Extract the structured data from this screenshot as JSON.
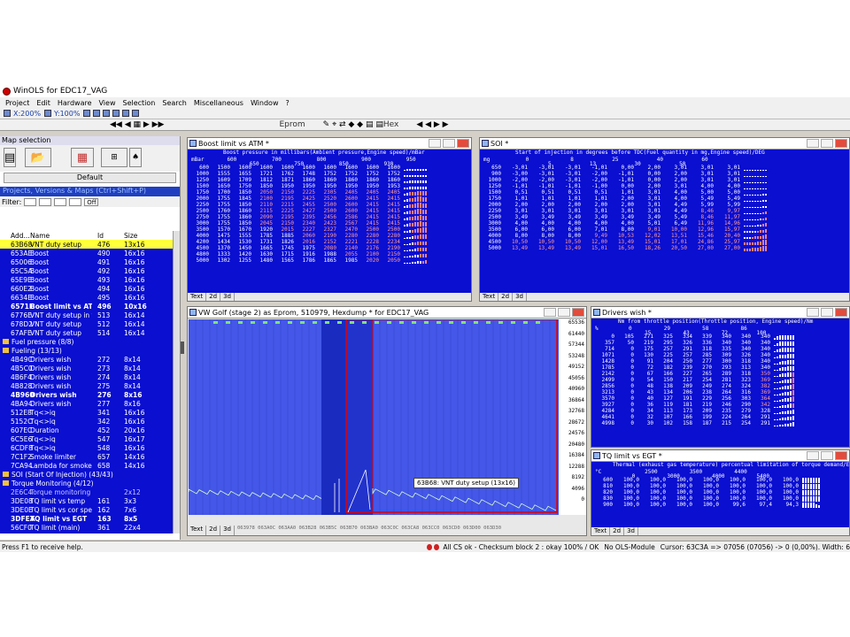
{
  "app": {
    "title": "WinOLS for EDC17_VAG"
  },
  "menu": [
    "Project",
    "Edit",
    "Hardware",
    "View",
    "Selection",
    "Search",
    "Miscellaneous",
    "Window",
    "?"
  ],
  "toolbar": {
    "zoom": "X:200%",
    "zoom2": "Y:100%",
    "eprom_label": "Eprom",
    "hex_label": "Hex"
  },
  "sidebar": {
    "title": "Map selection",
    "default_label": "Default",
    "projects_label": "Projects, Versions & Maps  (Ctrl+Shift+P)",
    "filter_label": "Filter:",
    "filter_btn": "Off",
    "columns": [
      "Add...",
      "Name",
      "Id",
      "Size"
    ],
    "rows": [
      {
        "a": "63B68",
        "n": "VNT duty setup",
        "i": "476",
        "s": "13x16",
        "type": "sel"
      },
      {
        "a": "653AE",
        "n": "Boost",
        "i": "490",
        "s": "16x16"
      },
      {
        "a": "65006",
        "n": "Boost",
        "i": "491",
        "s": "16x16"
      },
      {
        "a": "65C5A",
        "n": "Boost",
        "i": "492",
        "s": "16x16"
      },
      {
        "a": "65E9E",
        "n": "Boost",
        "i": "493",
        "s": "16x16"
      },
      {
        "a": "660E2",
        "n": "Boost",
        "i": "494",
        "s": "16x16"
      },
      {
        "a": "6634E",
        "n": "Boost",
        "i": "495",
        "s": "16x16"
      },
      {
        "a": "6571E",
        "n": "Boost limit vs ATM",
        "i": "496",
        "s": "10x16",
        "type": "bold"
      },
      {
        "a": "6776E",
        "n": "VNT duty setup in fail po",
        "i": "513",
        "s": "16x14"
      },
      {
        "a": "678D2",
        "n": "VNT duty setup",
        "i": "512",
        "s": "16x14"
      },
      {
        "a": "67AFE",
        "n": "VNT duty setup",
        "i": "514",
        "s": "16x14"
      },
      {
        "a": "",
        "n": "Fuel pressure (8/8)",
        "i": "",
        "s": "",
        "type": "hdr"
      },
      {
        "a": "",
        "n": "Fueling (13/13)",
        "i": "",
        "s": "",
        "type": "hdr"
      },
      {
        "a": "4B49C",
        "n": "Drivers wish",
        "i": "272",
        "s": "8x14"
      },
      {
        "a": "4B5C0",
        "n": "Drivers wish",
        "i": "273",
        "s": "8x14"
      },
      {
        "a": "4B6F4",
        "n": "Drivers wish",
        "i": "274",
        "s": "8x14"
      },
      {
        "a": "4B828",
        "n": "Drivers wish",
        "i": "275",
        "s": "8x14"
      },
      {
        "a": "4B960",
        "n": "Drivers wish",
        "i": "276",
        "s": "8x16",
        "type": "bold"
      },
      {
        "a": "4BA94",
        "n": "Drivers wish",
        "i": "277",
        "s": "8x16"
      },
      {
        "a": "512E8",
        "n": "Tq<>iq",
        "i": "341",
        "s": "16x16"
      },
      {
        "a": "5152C",
        "n": "Tq<>iq",
        "i": "342",
        "s": "16x16"
      },
      {
        "a": "607EC",
        "n": "Duration",
        "i": "452",
        "s": "20x16"
      },
      {
        "a": "6C5E6",
        "n": "Tq<>iq",
        "i": "547",
        "s": "16x17"
      },
      {
        "a": "6CDF8",
        "n": "Tq<>iq",
        "i": "548",
        "s": "16x16"
      },
      {
        "a": "7C1F2",
        "n": "Smoke limiter",
        "i": "657",
        "s": "14x16"
      },
      {
        "a": "7CA94",
        "n": "Lambda for smoke lim",
        "i": "658",
        "s": "14x16"
      },
      {
        "a": "",
        "n": "SOI (Start Of Injection) (43/43)",
        "i": "",
        "s": "",
        "type": "hdr"
      },
      {
        "a": "",
        "n": "Torque Monitoring (4/12)",
        "i": "",
        "s": "",
        "type": "hdr"
      },
      {
        "a": "2E6C4",
        "n": "Torque monitoring",
        "i": "",
        "s": "2x12",
        "type": "dim"
      },
      {
        "a": "3DE08",
        "n": "TQ limit vs temp",
        "i": "161",
        "s": "3x3"
      },
      {
        "a": "3DE0E",
        "n": "TQ limit vs cor speed",
        "i": "162",
        "s": "7x6"
      },
      {
        "a": "3DFEA",
        "n": "TQ limit vs EGT",
        "i": "163",
        "s": "8x5",
        "type": "bold"
      },
      {
        "a": "56CF0",
        "n": "TQ limit (main)",
        "i": "361",
        "s": "22x4"
      },
      {
        "a": "7E0FE",
        "n": "Global TQ limit",
        "i": "",
        "s": "1x1",
        "type": "dim"
      }
    ]
  },
  "windows": {
    "boost": {
      "title": "Boost limit vs ATM *",
      "header": "Boost pressure in millibars(Ambient pressure,Engine speed)/mBar",
      "corner": "mBar",
      "rowunit": "rpm",
      "cols_top": [
        "600",
        "",
        "700",
        "",
        "800",
        "",
        "900",
        "",
        "950"
      ],
      "cols_bottom": [
        "",
        "650",
        "",
        "750",
        "",
        "850",
        "",
        "930",
        ""
      ],
      "rows": [
        [
          "600",
          "1500",
          "1600",
          "1600",
          "1600",
          "1600",
          "1600",
          "1600",
          "1600",
          "1600"
        ],
        [
          "1000",
          "1555",
          "1655",
          "1721",
          "1762",
          "1748",
          "1752",
          "1752",
          "1752",
          "1752"
        ],
        [
          "1250",
          "1609",
          "1709",
          "1812",
          "1871",
          "1860",
          "1860",
          "1860",
          "1860",
          "1860"
        ],
        [
          "1500",
          "1650",
          "1750",
          "1850",
          "1950",
          "1950",
          "1950",
          "1950",
          "1950",
          "1953"
        ],
        [
          "1750",
          "1700",
          "1850",
          "2050",
          "2150",
          "2225",
          "2305",
          "2405",
          "2405",
          "2405"
        ],
        [
          "2000",
          "1755",
          "1845",
          "2100",
          "2195",
          "2425",
          "2520",
          "2600",
          "2415",
          "2415"
        ],
        [
          "2250",
          "1755",
          "1850",
          "2110",
          "2215",
          "2455",
          "2500",
          "2600",
          "2415",
          "2415"
        ],
        [
          "2500",
          "1760",
          "1860",
          "2115",
          "2225",
          "2427",
          "2500",
          "2600",
          "2415",
          "2415"
        ],
        [
          "2750",
          "1755",
          "1860",
          "2090",
          "2195",
          "2395",
          "2456",
          "2586",
          "2415",
          "2415"
        ],
        [
          "3000",
          "1755",
          "1850",
          "2045",
          "2150",
          "2340",
          "2423",
          "2567",
          "2415",
          "2415"
        ],
        [
          "3500",
          "1570",
          "1670",
          "1920",
          "2015",
          "2227",
          "2327",
          "2470",
          "2500",
          "2500"
        ],
        [
          "4000",
          "1475",
          "1555",
          "1785",
          "1885",
          "2060",
          "2190",
          "2280",
          "2280",
          "2280"
        ],
        [
          "4200",
          "1434",
          "1530",
          "1731",
          "1826",
          "2016",
          "2152",
          "2221",
          "2228",
          "2234"
        ],
        [
          "4500",
          "1370",
          "1450",
          "1665",
          "1745",
          "1975",
          "2080",
          "2140",
          "2176",
          "2190"
        ],
        [
          "4800",
          "1333",
          "1420",
          "1630",
          "1715",
          "1916",
          "1988",
          "2055",
          "2100",
          "2150"
        ],
        [
          "5000",
          "1302",
          "1255",
          "1480",
          "1565",
          "1786",
          "1865",
          "1985",
          "2020",
          "2050"
        ]
      ],
      "tabs": [
        "Text",
        "2d",
        "3d"
      ]
    },
    "soi": {
      "title": "SOI *",
      "header": "Start of injection in degrees before TDC(Fuel quantity in mg,Engine speed)/DEG",
      "corner": "mg",
      "rowunit": "rpm",
      "cols_top": [
        "0",
        "",
        "8",
        "",
        "25",
        "",
        "40",
        "",
        "60"
      ],
      "cols_bottom": [
        "",
        "5",
        "",
        "13",
        "",
        "30",
        "",
        "50",
        ""
      ],
      "rows": [
        [
          "650",
          "-3,01",
          "-3,01",
          "-3,01",
          "-1,01",
          "0,00",
          "2,00",
          "3,01",
          "3,01",
          "3,01"
        ],
        [
          "900",
          "-3,00",
          "-3,01",
          "-3,01",
          "-2,00",
          "-1,01",
          "0,00",
          "2,00",
          "3,01",
          "3,01"
        ],
        [
          "1000",
          "-2,00",
          "-2,00",
          "-3,01",
          "-2,00",
          "-1,01",
          "0,00",
          "2,00",
          "3,01",
          "3,01"
        ],
        [
          "1250",
          "-1,01",
          "-1,01",
          "-1,01",
          "-1,00",
          "0,00",
          "2,00",
          "3,01",
          "4,00",
          "4,00"
        ],
        [
          "1500",
          "0,51",
          "0,51",
          "0,51",
          "0,51",
          "1,01",
          "3,01",
          "4,00",
          "5,00",
          "5,00"
        ],
        [
          "1750",
          "1,01",
          "1,01",
          "1,01",
          "1,01",
          "2,00",
          "3,01",
          "4,00",
          "5,49",
          "5,49"
        ],
        [
          "2000",
          "2,00",
          "2,00",
          "2,00",
          "2,00",
          "2,00",
          "3,01",
          "4,49",
          "5,99",
          "5,99"
        ],
        [
          "2250",
          "3,01",
          "3,01",
          "3,01",
          "3,01",
          "3,01",
          "3,01",
          "4,49",
          "8,46",
          "9,97"
        ],
        [
          "2500",
          "3,49",
          "3,49",
          "3,49",
          "3,49",
          "3,49",
          "3,49",
          "5,49",
          "8,46",
          "11,97"
        ],
        [
          "3000",
          "4,00",
          "4,00",
          "4,00",
          "4,00",
          "4,00",
          "5,01",
          "6,49",
          "11,96",
          "14,96"
        ],
        [
          "3500",
          "6,00",
          "6,00",
          "6,00",
          "7,01",
          "8,00",
          "9,01",
          "10,00",
          "12,96",
          "15,97"
        ],
        [
          "4000",
          "8,00",
          "8,00",
          "8,00",
          "9,49",
          "10,53",
          "12,02",
          "13,51",
          "15,46",
          "20,40"
        ],
        [
          "4500",
          "10,50",
          "10,50",
          "10,50",
          "12,00",
          "13,49",
          "15,01",
          "17,01",
          "24,86",
          "25,97"
        ],
        [
          "5000",
          "13,49",
          "13,49",
          "13,49",
          "15,01",
          "16,50",
          "18,26",
          "20,50",
          "27,00",
          "27,00"
        ]
      ],
      "tabs": [
        "Text",
        "2d",
        "3d"
      ]
    },
    "graph": {
      "title": "VW Golf (stage 2) as Eprom, 510979, Hexdump * for EDC17_VAG",
      "tooltip": "63B68: VNT duty setup (13x16)",
      "yaxis": [
        "65536",
        "61440",
        "57344",
        "53248",
        "49152",
        "45056",
        "40960",
        "36864",
        "32768",
        "28672",
        "24576",
        "20480",
        "16384",
        "12288",
        "8192",
        "4096",
        "0"
      ],
      "xaxis": "063978 063A0C 063AA0 063B28 063B5C 063B70 063BA0 063C0C 063CA8 063CC0 063CD0 063D00 063D30",
      "tabs": [
        "Text",
        "2d",
        "3d"
      ]
    },
    "drivers": {
      "title": "Drivers wish *",
      "header": "Nm from throttle position(Throttle position, Engine speed)/Nm",
      "corner": "%",
      "rowunit": "rpm",
      "cols_top": [
        "0",
        "",
        "29",
        "",
        "58",
        "",
        "86"
      ],
      "cols_bottom": [
        "",
        "15",
        "",
        "43",
        "",
        "72",
        "",
        "100"
      ],
      "rows": [
        [
          "0",
          "105",
          "271",
          "325",
          "334",
          "339",
          "340",
          "340",
          "340"
        ],
        [
          "357",
          "50",
          "219",
          "295",
          "326",
          "336",
          "340",
          "340",
          "340"
        ],
        [
          "714",
          "0",
          "175",
          "257",
          "291",
          "318",
          "335",
          "340",
          "340"
        ],
        [
          "1071",
          "0",
          "130",
          "225",
          "257",
          "285",
          "309",
          "326",
          "340"
        ],
        [
          "1428",
          "0",
          "91",
          "204",
          "250",
          "277",
          "300",
          "318",
          "340"
        ],
        [
          "1785",
          "0",
          "72",
          "182",
          "239",
          "270",
          "293",
          "313",
          "340"
        ],
        [
          "2142",
          "0",
          "67",
          "166",
          "227",
          "265",
          "289",
          "318",
          "350"
        ],
        [
          "2499",
          "0",
          "54",
          "150",
          "217",
          "254",
          "281",
          "323",
          "369"
        ],
        [
          "2856",
          "0",
          "48",
          "138",
          "209",
          "249",
          "274",
          "324",
          "382"
        ],
        [
          "3213",
          "0",
          "43",
          "134",
          "206",
          "238",
          "264",
          "316",
          "369"
        ],
        [
          "3570",
          "0",
          "40",
          "127",
          "191",
          "229",
          "256",
          "303",
          "364"
        ],
        [
          "3927",
          "0",
          "36",
          "119",
          "181",
          "219",
          "246",
          "290",
          "342"
        ],
        [
          "4284",
          "0",
          "34",
          "113",
          "173",
          "209",
          "235",
          "279",
          "328"
        ],
        [
          "4641",
          "0",
          "32",
          "107",
          "166",
          "199",
          "224",
          "264",
          "291"
        ],
        [
          "4998",
          "0",
          "30",
          "102",
          "158",
          "187",
          "215",
          "254",
          "291"
        ]
      ],
      "tabs": [
        "Text",
        "2d",
        "3d"
      ]
    },
    "tq": {
      "title": "TQ limit vs EGT *",
      "header": "Thermal (exhaust gas temperature) percentual limitation of torque demand/Engine",
      "corner": "°C",
      "cols_top": [
        "",
        "2500",
        "",
        "3500",
        "",
        "4400",
        ""
      ],
      "cols_bottom": [
        "0",
        "",
        "3000",
        "",
        "4000",
        "",
        "5400"
      ],
      "rows": [
        [
          "600",
          "100,0",
          "100,0",
          "100,0",
          "100,0",
          "100,0",
          "100,0",
          "100,0"
        ],
        [
          "810",
          "100,0",
          "100,0",
          "100,0",
          "100,0",
          "100,0",
          "100,0",
          "100,0"
        ],
        [
          "820",
          "100,0",
          "100,0",
          "100,0",
          "100,0",
          "100,0",
          "100,0",
          "100,0"
        ],
        [
          "830",
          "100,0",
          "100,0",
          "100,0",
          "100,0",
          "100,0",
          "100,0",
          "100,0"
        ],
        [
          "900",
          "100,0",
          "100,0",
          "100,0",
          "100,0",
          "99,6",
          "97,4",
          "94,3"
        ]
      ],
      "tabs": [
        "Text",
        "2d",
        "3d"
      ]
    }
  },
  "status": {
    "help": "Press F1 to receive help.",
    "checksum": "All CS ok - Checksum block 2 : okay 100% / OK",
    "module": "No OLS-Module",
    "cursor": "Cursor: 63C3A => 07056 (07056) -> 0 (0,00%). Width: 6"
  },
  "colors": {
    "map_bg": "#0a0fd0",
    "graph_bg": "#4457e8",
    "selection": "#ffff3c",
    "highlight_value": "#ff9c9c",
    "graph_box": "#e00000"
  }
}
